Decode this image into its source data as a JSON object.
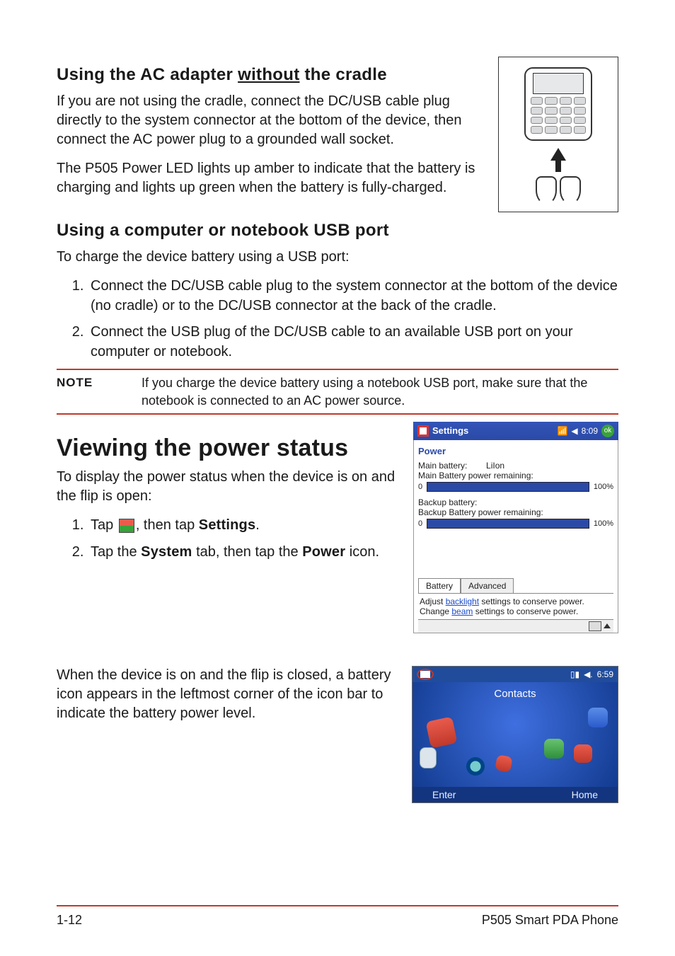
{
  "section1": {
    "heading_part1": "Using the AC adapter ",
    "heading_underlined": "without",
    "heading_part2": " the cradle",
    "para1": "If you are not using the cradle, connect the DC/USB cable plug directly to the system connector at the bottom of the device, then connect the AC power plug to a grounded wall socket.",
    "para2": "The P505 Power LED lights up amber to indicate that the battery is charging and lights up green when the battery is fully-charged."
  },
  "section2": {
    "heading": "Using a computer or notebook USB port",
    "intro": "To charge the device battery using a USB port:",
    "steps": [
      "Connect the DC/USB cable plug to the system connector at the bottom of the device (no cradle) or to the DC/USB connector at the back of the cradle.",
      "Connect the USB plug of the DC/USB cable to an available USB port on your computer or notebook."
    ]
  },
  "note": {
    "label": "NOTE",
    "text": "If you charge the device battery using a notebook USB port, make sure that the notebook is connected to an AC power source."
  },
  "section3": {
    "heading": "Viewing the power status",
    "intro": "To display the power status when the device is on and the flip is open:",
    "step1_a": "Tap ",
    "step1_b": ", then tap ",
    "step1_bold": "Settings",
    "step1_c": ".",
    "step2_a": "Tap the ",
    "step2_b1": "System",
    "step2_c": " tab, then tap the ",
    "step2_b2": "Power",
    "step2_d": " icon.",
    "closed_para": "When the device is on and the flip is closed, a battery icon appears in the leftmost corner of the icon bar to indicate the battery power level."
  },
  "settings_shot": {
    "title": "Settings",
    "time": "8:09",
    "ok": "ok",
    "section": "Power",
    "main_label": "Main battery:",
    "main_type": "LiIon",
    "main_remaining": "Main Battery power remaining:",
    "zero": "0",
    "hundred": "100%",
    "backup_label": "Backup battery:",
    "backup_remaining": "Backup Battery power remaining:",
    "tab_battery": "Battery",
    "tab_advanced": "Advanced",
    "hint1a": "Adjust ",
    "hint1link": "backlight",
    "hint1b": " settings to conserve power.",
    "hint2a": "Change ",
    "hint2link": "beam",
    "hint2b": " settings to conserve power."
  },
  "home_shot": {
    "time": "6:59",
    "title": "Contacts",
    "left_soft": "Enter",
    "right_soft": "Home"
  },
  "footer": {
    "left": "1-12",
    "right": "P505 Smart PDA Phone"
  }
}
